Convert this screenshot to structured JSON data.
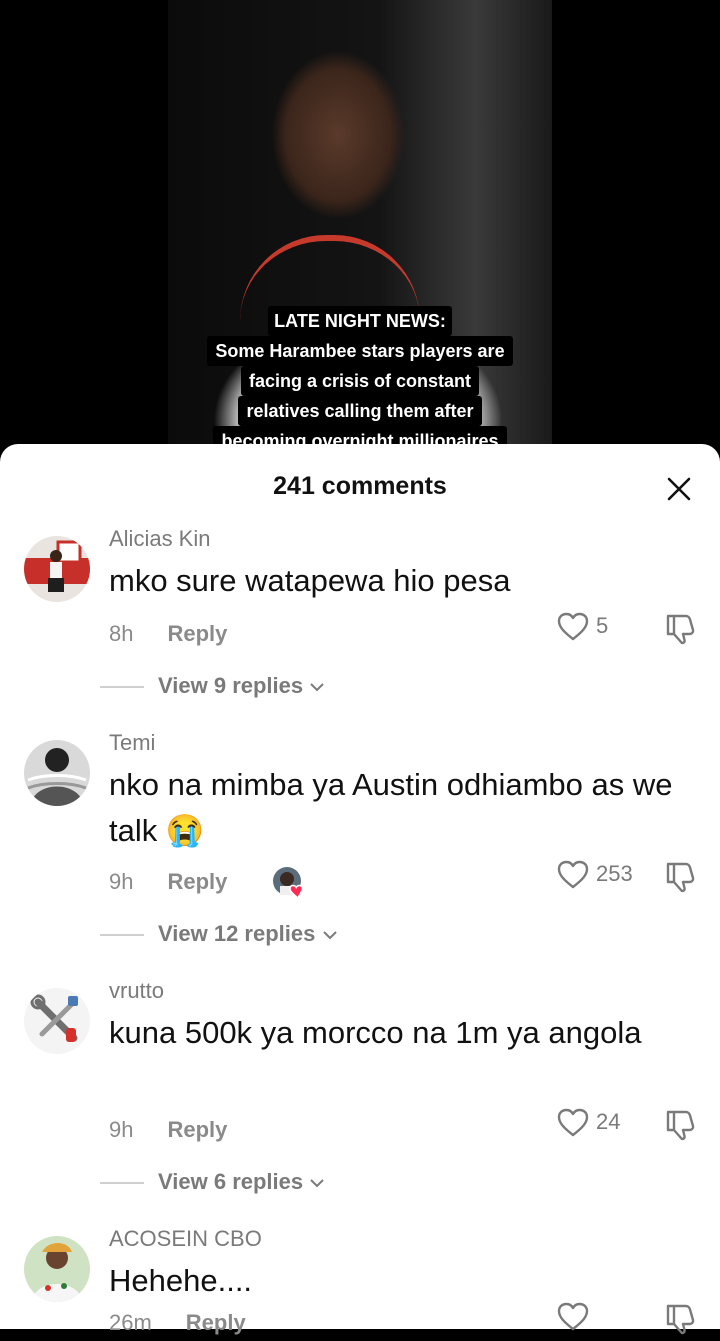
{
  "video": {
    "caption_lines": [
      "LATE NIGHT NEWS:",
      "Some Harambee stars players are",
      "facing a crisis of constant",
      "relatives calling them after",
      "becoming overnight millionaires"
    ]
  },
  "sheet": {
    "title": "241 comments",
    "close_icon": "close-icon"
  },
  "comments": [
    {
      "user": "Alicias Kin",
      "text": "mko sure watapewa hio pesa",
      "time": "8h",
      "reply": "Reply",
      "likes": "5",
      "view": "View 9 replies"
    },
    {
      "user": "Temi",
      "text": "nko na mimba ya Austin odhiambo as we talk 😭",
      "time": "9h",
      "reply": "Reply",
      "likes": "253",
      "view": "View 12 replies"
    },
    {
      "user": "vrutto",
      "text": "kuna 500k ya morcco na 1m ya angola",
      "time": "9h",
      "reply": "Reply",
      "likes": "24",
      "view": "View 6 replies"
    },
    {
      "user": "ACOSEIN CBO",
      "text": "Hehehe....",
      "time": "26m",
      "reply": "Reply"
    }
  ],
  "colors": {
    "accent_heart": "#fe2c55",
    "caption_bg": "#000000"
  }
}
